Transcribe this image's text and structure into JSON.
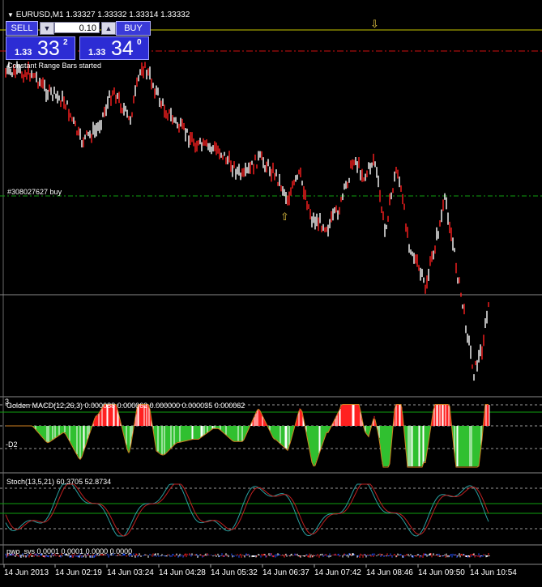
{
  "chart": {
    "symbol_line": "EURUSD,M1  1.33327 1.33332 1.33314 1.33332",
    "status_comment": "Constant Range Bars started",
    "order_label": "#308027627 buy",
    "colors": {
      "bull": "#ffffff",
      "bear": "#ff2020",
      "ask_line": "#c8c800",
      "stop_line": "#d01010",
      "order_line": "#10a010",
      "grid": "#9a9a9a"
    }
  },
  "trade_panel": {
    "sell_label": "SELL",
    "buy_label": "BUY",
    "lot_value": "0.10",
    "sell_price_prefix": "1.33",
    "sell_price_big": "33",
    "sell_price_sup": "2",
    "buy_price_prefix": "1.33",
    "buy_price_big": "34",
    "buy_price_sup": "0"
  },
  "indicators": {
    "macd_window_index": "3",
    "macd_label": "Golden MACD(12,26,3) 0.000088 0.000062 0.000000 0.000035 0.000062",
    "macd_level": "-D2",
    "stoch_label": "Stoch(13,5,21) 60.3705 52.8734",
    "pwo_label": "pwo_svs 0.0001 0.0001 0.0000 0.0000"
  },
  "time_axis": [
    "14 Jun 2013",
    "14 Jun 02:19",
    "14 Jun 03:24",
    "14 Jun 04:28",
    "14 Jun 05:32",
    "14 Jun 06:37",
    "14 Jun 07:42",
    "14 Jun 08:46",
    "14 Jun 09:50",
    "14 Jun 10:54"
  ],
  "arrows": {
    "down": "⇩",
    "up": "⇧",
    "arrow_color": "#e0c040"
  }
}
